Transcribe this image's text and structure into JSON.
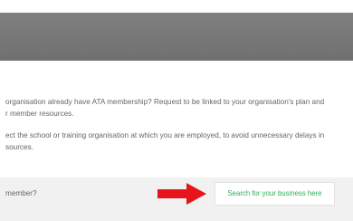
{
  "intro": {
    "line1": "organisation already have ATA membership? Request to be linked to your organisation's plan and",
    "line2": "r member resources.",
    "line3": "ect the school or training organisation at which you are employed, to avoid unnecessary delays in",
    "line4": "sources."
  },
  "action": {
    "label": "member?",
    "search_button": "Search for your business here"
  },
  "colors": {
    "header": "#777777",
    "band": "#f1f1f1",
    "arrow": "#e8141b",
    "button_text": "#2fae55"
  },
  "icons": [
    "arrow-right-icon"
  ]
}
